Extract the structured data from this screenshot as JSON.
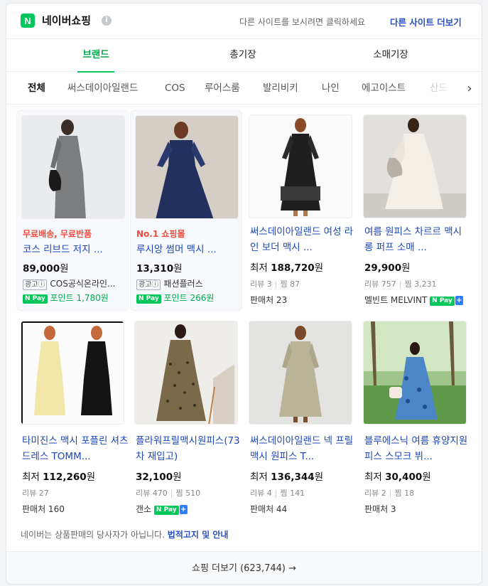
{
  "header": {
    "logo_letter": "N",
    "title": "네이버쇼핑",
    "info_glyph": "i",
    "hint": "다른 사이트를 보시려면 클릭하세요",
    "more_sites": "다른 사이트 더보기"
  },
  "tabs": [
    {
      "label": "브랜드",
      "active": true
    },
    {
      "label": "총기장",
      "active": false
    },
    {
      "label": "소매기장",
      "active": false
    }
  ],
  "categories": [
    "전체",
    "써스데이아일랜드",
    "COS",
    "루어스룸",
    "발리비키",
    "나인",
    "에고이스트",
    "산드"
  ],
  "category_next_glyph": "›",
  "products": [
    {
      "promo": "무료배송, 무료반품",
      "name": "코스 리브드 저지 ...",
      "price_prefix": "",
      "price": "89,000",
      "price_unit": "원",
      "ad_label": "광고ⓘ",
      "seller": "COS공식온라인...",
      "npay": "N Pay",
      "point": "포인트 1,780원"
    },
    {
      "promo": "No.1 쇼핑몰",
      "name": "루시앙 썸머 맥시 ...",
      "price_prefix": "",
      "price": "13,310",
      "price_unit": "원",
      "ad_label": "광고ⓘ",
      "seller": "패션플러스",
      "npay": "N Pay",
      "point": "포인트 266원"
    },
    {
      "name": "써스데이아일랜드 여성 라인 보더 맥시 ...",
      "price_prefix": "최저",
      "price": "188,720",
      "price_unit": "원",
      "review": "리뷰 3",
      "zzim": "찜 87",
      "seller": "판매처 23"
    },
    {
      "name": "여름 원피스 차르르 맥시 롱 퍼프 소매 ...",
      "price_prefix": "",
      "price": "29,900",
      "price_unit": "원",
      "review": "리뷰 757",
      "zzim": "찜 3,231",
      "seller": "멜빈트 MELVINT",
      "npay": "N Pay",
      "npay_plus": "+"
    },
    {
      "name": "타미진스 맥시 포플린 셔츠 드레스 TOMM...",
      "price_prefix": "최저",
      "price": "112,260",
      "price_unit": "원",
      "review": "리뷰 27",
      "seller": "판매처 160"
    },
    {
      "name": "플라워프릴맥시원피스(73차 재입고)",
      "price_prefix": "",
      "price": "32,100",
      "price_unit": "원",
      "review": "리뷰 470",
      "zzim": "찜 510",
      "seller": "갠소",
      "npay": "N Pay",
      "npay_plus": "+"
    },
    {
      "name": "써스데이아일랜드 넥 프릴 맥시 원피스 T...",
      "price_prefix": "최저",
      "price": "136,344",
      "price_unit": "원",
      "review": "리뷰 4",
      "zzim": "찜 141",
      "seller": "판매처 44"
    },
    {
      "name": "블루에스닉 여름 휴양지원피스 스모크 뷔...",
      "price_prefix": "최저",
      "price": "30,400",
      "price_unit": "원",
      "review": "리뷰 2",
      "zzim": "찜 18",
      "seller": "판매처 3"
    }
  ],
  "footer": {
    "notice": "네이버는 상품판매의 당사자가 아닙니다.",
    "notice_link": "법적고지 및 안내",
    "more_shopping": "쇼핑 더보기 (623,744) →"
  },
  "colors": {
    "brand_green": "#03c75a",
    "link_blue": "#1d47b8",
    "promo_red": "#ef4a3b"
  }
}
